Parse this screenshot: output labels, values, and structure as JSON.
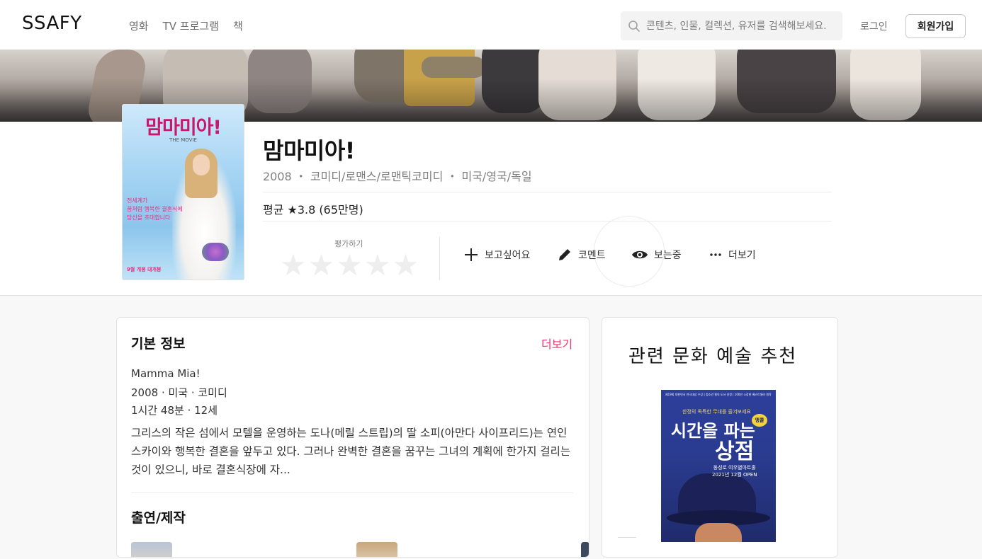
{
  "header": {
    "logo": "SSAFY",
    "nav": [
      "영화",
      "TV 프로그램",
      "책"
    ],
    "search_placeholder": "콘텐츠, 인물, 컬렉션, 유저를 검색해보세요.",
    "login": "로그인",
    "signup": "회원가입"
  },
  "movie": {
    "poster": {
      "title": "맘마미아!",
      "subtitle": "THE MOVIE",
      "tagline": "전세계가\n꿈처럼 행복한 결혼식에\n당신을 초대합니다",
      "release": "9월 개봉 대개봉"
    },
    "title": "맘마미아!",
    "meta": "2008 ・ 코미디/로맨스/로맨틱코미디 ・ 미국/영국/독일",
    "average": "평균 ★3.8 (65만명)",
    "rate_label": "평가하기",
    "actions": {
      "want": "보고싶어요",
      "comment": "코멘트",
      "watching": "보는중",
      "more": "더보기"
    }
  },
  "basic_info": {
    "title": "기본 정보",
    "more": "더보기",
    "original_title": "Mamma Mia!",
    "year_country_genre": "2008 · 미국 · 코미디",
    "runtime_rating": "1시간 48분 · 12세",
    "description": "그리스의 작은 섬에서 모텔을 운영하는 도나(메릴 스트립)의 딸 소피(아만다 사이프리드)는 연인 스카이와 행복한 결혼을 앞두고 있다. 그러나 완벽한 결혼을 꿈꾸는 그녀의 계획에 한가지 걸리는 것이 있으니, 바로 결혼식장에 자..."
  },
  "cast": {
    "title": "출연/제작"
  },
  "recommend": {
    "title": "관련 문화 예술 추천",
    "poster": {
      "top_text": "제19회 대한민국 연극대상 수상 | 청소년 필독 도서 선정 | 100만 소장판 베스트셀러 원작",
      "small": "한정의 독특한 무대를 즐겨보세요",
      "title_line1": "시간을 파는",
      "title_line2": "상점",
      "sticker": "앵콜",
      "venue": "동성로 여우별아트홀",
      "opening": "2021년 12월 OPEN"
    }
  },
  "colors": {
    "accent_pink": "#ff2f6e",
    "star_empty": "#eeeeee"
  }
}
